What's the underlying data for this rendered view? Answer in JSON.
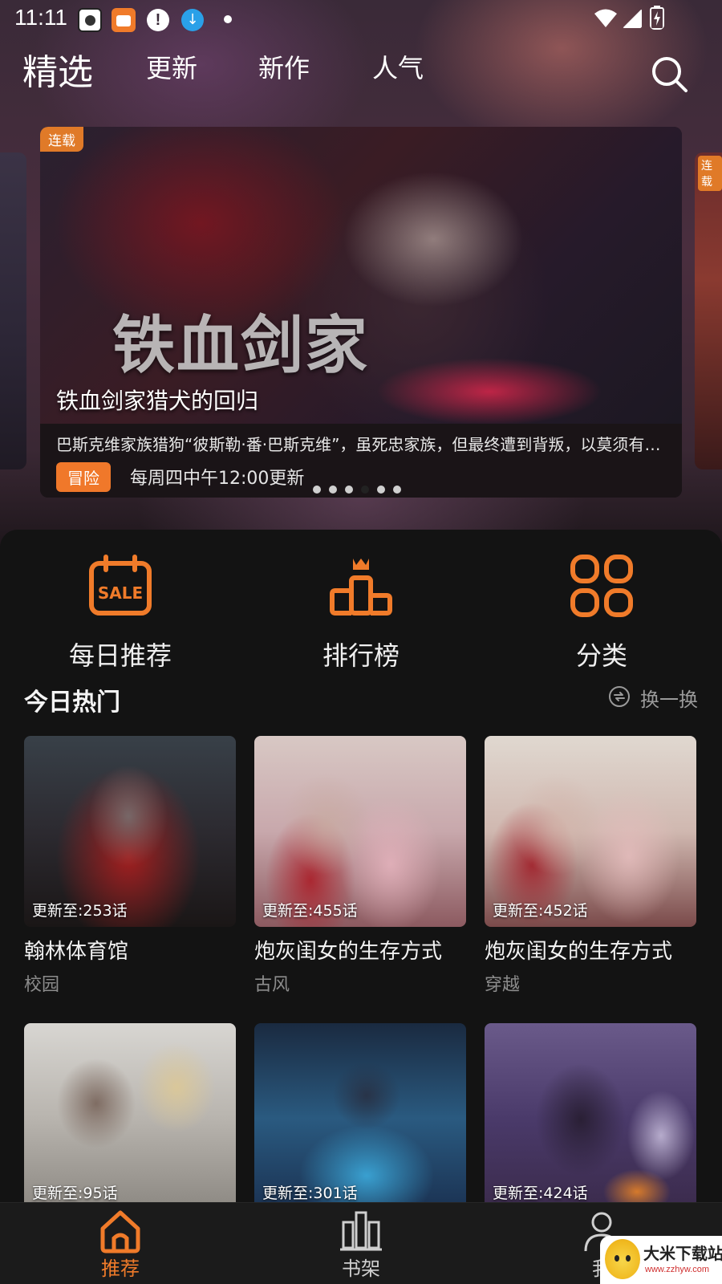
{
  "status_bar": {
    "time": "11:11"
  },
  "top_nav": {
    "tabs": [
      {
        "label": "精选",
        "active": true
      },
      {
        "label": "更新",
        "active": false
      },
      {
        "label": "新作",
        "active": false
      },
      {
        "label": "人气",
        "active": false
      }
    ],
    "search_icon": "search-icon"
  },
  "banner": {
    "status_tag": "连载",
    "art_title": "铁血剑家",
    "title": "铁血剑家猎犬的回归",
    "description": "巴斯克维家族猎狗“彼斯勒·番·巴斯克维”，虽死忠家族，但最终遭到背叛，以莫须有的...",
    "genre": "冒险",
    "schedule": "每周四中午12:00更新",
    "dot_count": 6,
    "active_dot": 3,
    "side_right_tag": "连载"
  },
  "quick_entries": [
    {
      "label": "每日推荐",
      "icon": "sale-calendar-icon"
    },
    {
      "label": "排行榜",
      "icon": "podium-crown-icon"
    },
    {
      "label": "分类",
      "icon": "grid-category-icon"
    }
  ],
  "hot_section": {
    "title": "今日热门",
    "refresh_label": "换一换"
  },
  "comics": [
    {
      "update": "更新至:253话",
      "title": "翰林体育馆",
      "genre": "校园"
    },
    {
      "update": "更新至:455话",
      "title": "炮灰闺女的生存方式",
      "genre": "古风"
    },
    {
      "update": "更新至:452话",
      "title": "炮灰闺女的生存方式",
      "genre": "穿越"
    },
    {
      "update": "更新至:95话",
      "title": "",
      "genre": ""
    },
    {
      "update": "更新至:301话",
      "title": "",
      "genre": ""
    },
    {
      "update": "更新至:424话",
      "title": "",
      "genre": ""
    }
  ],
  "bottom_nav": [
    {
      "label": "推荐",
      "icon": "home-icon",
      "active": true
    },
    {
      "label": "书架",
      "icon": "bookshelf-icon",
      "active": false
    },
    {
      "label": "我",
      "icon": "user-icon",
      "active": false
    }
  ],
  "watermark": {
    "text": "大米下载站",
    "url": "www.zzhyw.com"
  },
  "colors": {
    "accent": "#f07b2a",
    "background": "#131313"
  }
}
